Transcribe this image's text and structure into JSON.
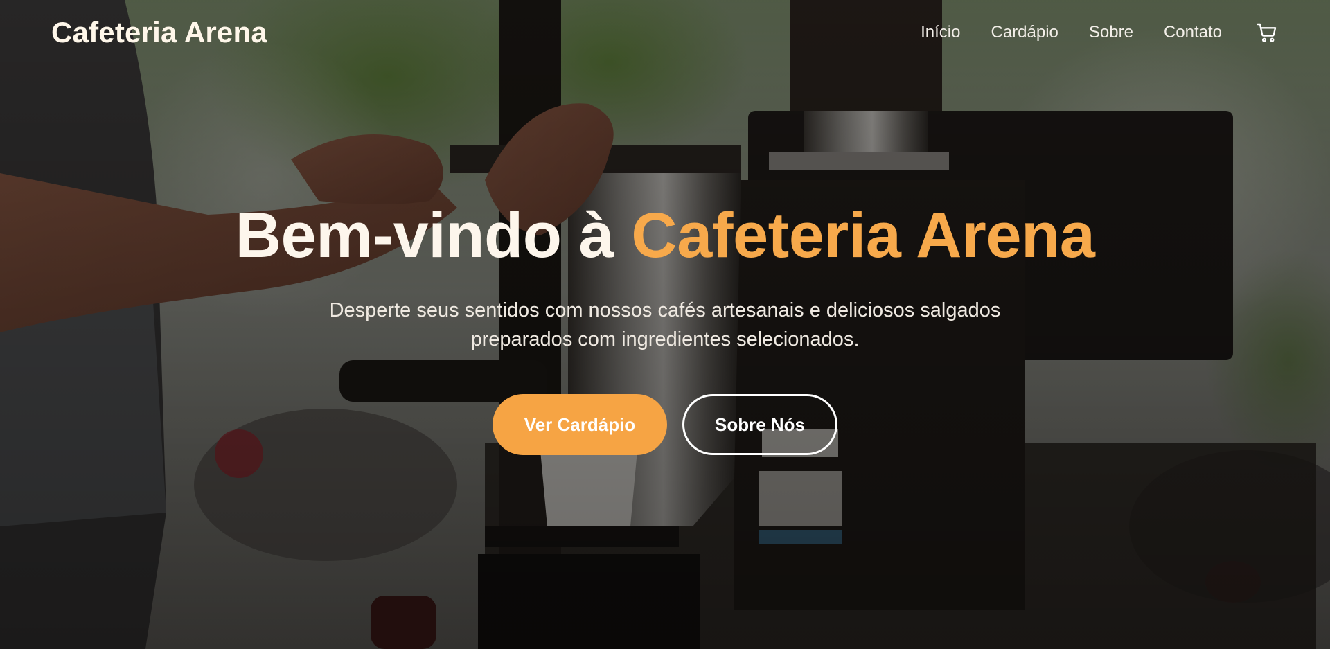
{
  "brand": {
    "name": "Cafeteria Arena"
  },
  "nav": {
    "items": [
      {
        "label": "Início"
      },
      {
        "label": "Cardápio"
      },
      {
        "label": "Sobre"
      },
      {
        "label": "Contato"
      }
    ],
    "cart_icon": "cart-icon"
  },
  "hero": {
    "headline_prefix": "Bem-vindo à ",
    "headline_accent": "Cafeteria Arena",
    "subtitle": "Desperte seus sentidos com nossos cafés artesanais e deliciosos salgados preparados com ingredientes selecionados.",
    "primary_button": "Ver Cardápio",
    "secondary_button": "Sobre Nós"
  },
  "colors": {
    "accent": "#f6a444",
    "headline_accent": "#f7a94b",
    "text_light": "#fdf6ec"
  }
}
